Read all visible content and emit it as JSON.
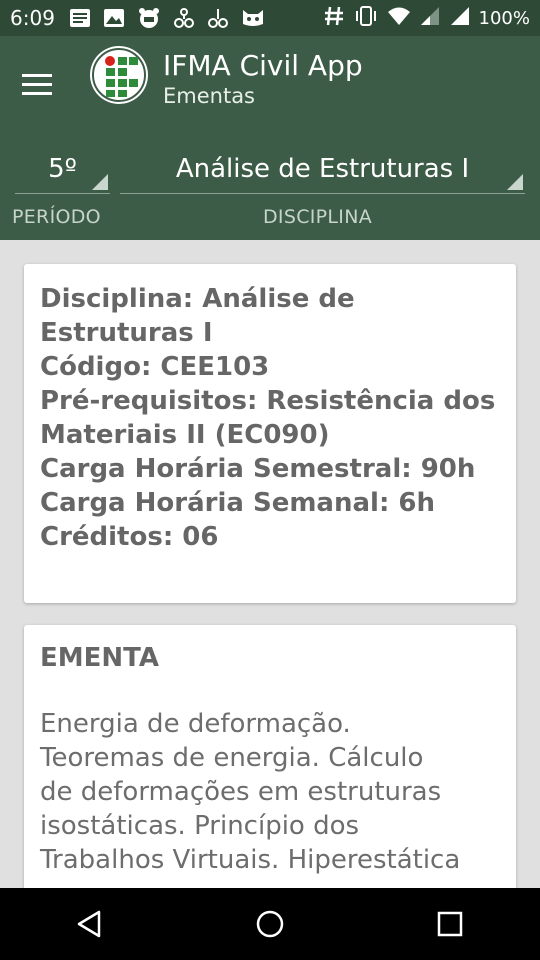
{
  "status": {
    "time": "6:09",
    "battery": "100%",
    "left_icons": [
      "notes-icon",
      "image-icon",
      "badge-icon",
      "fork-icon",
      "fork-icon",
      "cat-icon"
    ],
    "right_icons": [
      "hash-icon",
      "vibrate-icon",
      "wifi-icon",
      "signal-icon",
      "signal-icon"
    ]
  },
  "appbar": {
    "title": "IFMA Civil App",
    "subtitle": "Ementas",
    "periodo_value": "5º",
    "disciplina_value": "Análise de Estruturas I",
    "periodo_label": "PERÍODO",
    "disciplina_label": "DISCIPLINA"
  },
  "info_card": {
    "lines": [
      "Disciplina: Análise de",
      "Estruturas I",
      "Código: CEE103",
      "Pré-requisitos: Resistência dos",
      "Materiais II (EC090)",
      "Carga Horária Semestral: 90h",
      "Carga Horária Semanal: 6h",
      "Créditos: 06"
    ]
  },
  "ementa_card": {
    "heading": "EMENTA",
    "lines": [
      "Energia de deformação.",
      "Teoremas de energia. Cálculo",
      "de deformações em estruturas",
      "isostáticas. Princípio dos",
      "Trabalhos Virtuais. Hiperestática"
    ]
  },
  "colors": {
    "statusbar": "#2e4a36",
    "appbar": "#3d5c47",
    "background": "#e0e0e0"
  }
}
